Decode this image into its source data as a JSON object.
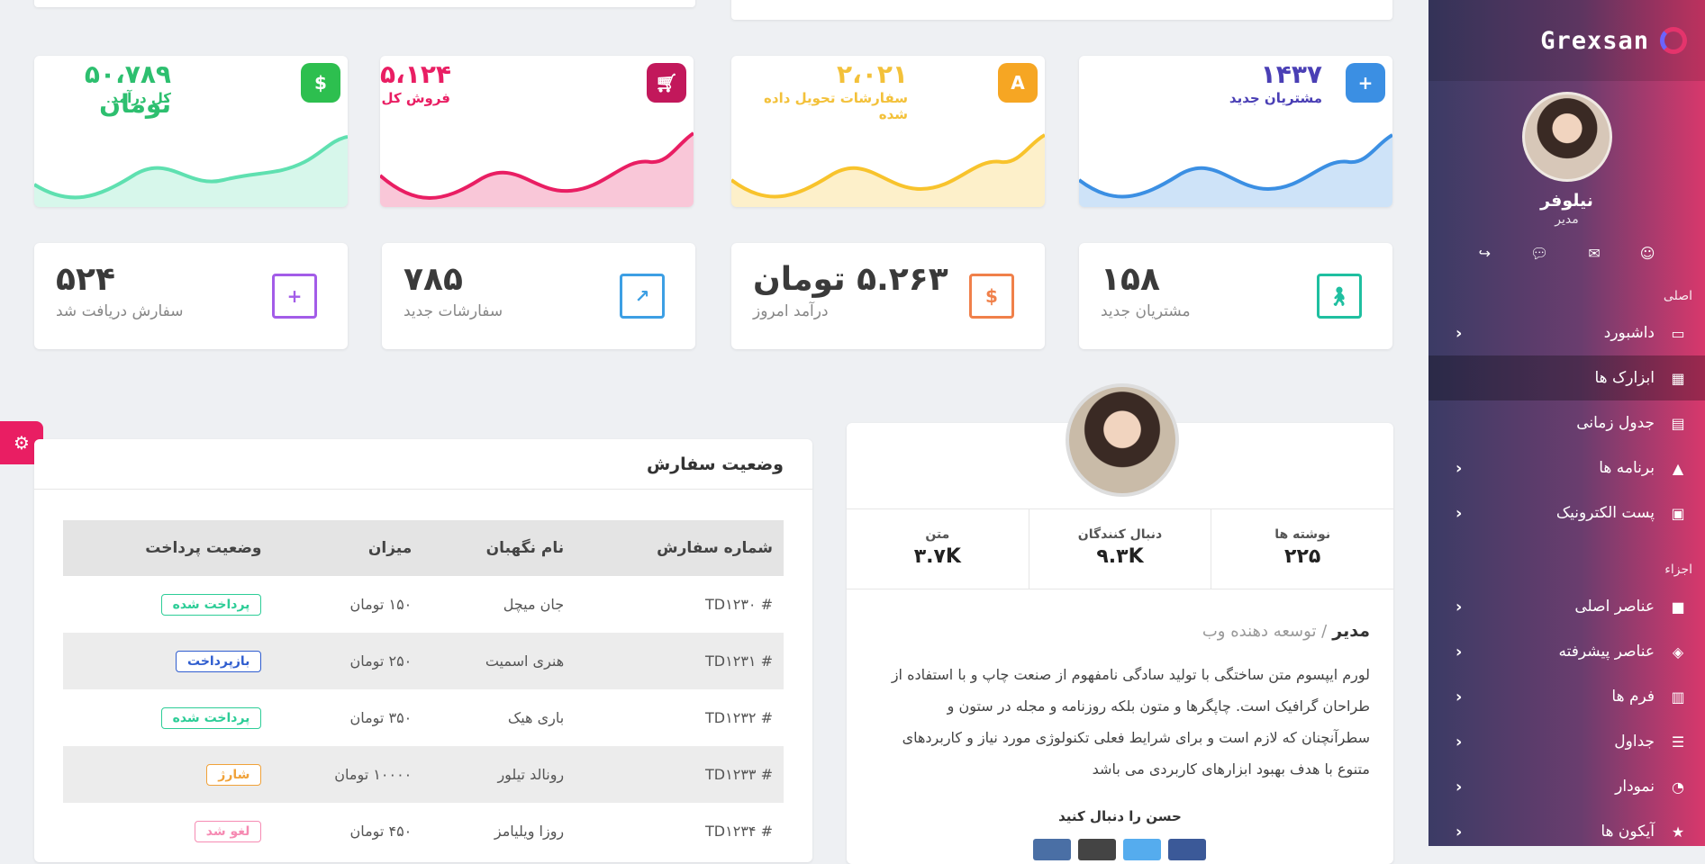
{
  "brand": {
    "name": "Grexsan"
  },
  "user": {
    "name": "نیلوفر",
    "role": "مدیر"
  },
  "sidebar": {
    "sections": [
      "اصلی",
      "اجزاء"
    ],
    "items": [
      {
        "label": "داشبورد",
        "icon": "monitor-icon"
      },
      {
        "label": "ابزارک ها",
        "icon": "widgets-icon"
      },
      {
        "label": "جدول زمانی",
        "icon": "calendar-icon"
      },
      {
        "label": "برنامه ها",
        "icon": "apps-icon"
      },
      {
        "label": "پست الکترونیک",
        "icon": "inbox-icon"
      },
      {
        "label": "عناصر اصلی",
        "icon": "briefcase-icon"
      },
      {
        "label": "عناصر پیشرفته",
        "icon": "cubes-icon"
      },
      {
        "label": "فرم ها",
        "icon": "form-icon"
      },
      {
        "label": "جداول",
        "icon": "table-icon"
      },
      {
        "label": "نمودار",
        "icon": "chart-icon"
      },
      {
        "label": "آیکون ها",
        "icon": "icons-icon"
      }
    ]
  },
  "wave_cards": [
    {
      "value": "۱۴۳۷",
      "label": "مشتریان جدید",
      "color": "#3b8fe3",
      "icon": "user-plus-icon"
    },
    {
      "value": "۲،۰۲۱",
      "label": "سفارشات تحویل داده شده",
      "color": "#f8c32c",
      "icon": "compass-icon"
    },
    {
      "value": "۵،۱۲۴",
      "label": "فروش کل",
      "color": "#e91e63",
      "icon": "cart-icon"
    },
    {
      "value": "۵۰،۷۸۹ تومان",
      "label": "کل درآمد",
      "color": "#2dbf6f",
      "icon": "dollar-icon"
    }
  ],
  "mini_cards": [
    {
      "value": "۱۵۸",
      "label": "مشتریان جدید",
      "color": "#1fbfa0",
      "icon": "person-walking-icon"
    },
    {
      "value": "۵.۲۶۳ تومان",
      "label": "درآمد امروز",
      "color": "#f0804a",
      "icon": "dollar-icon"
    },
    {
      "value": "۷۸۵",
      "label": "سفارشات جدید",
      "color": "#3d9fe4",
      "icon": "trend-icon"
    },
    {
      "value": "۵۲۴",
      "label": "سفارش دریافت شد",
      "color": "#a35ce8",
      "icon": "cart-plus-icon"
    }
  ],
  "orders": {
    "title": "وضعیت سفارش",
    "headers": [
      "شماره سفارش",
      "نام نگهبان",
      "میزان",
      "وضعیت پرداخت"
    ],
    "rows": [
      {
        "id": "# TD۱۲۳۰",
        "name": "جان میچل",
        "amount": "۱۵۰ تومان",
        "status": "پرداخت شده",
        "status_color": "#2dcd97"
      },
      {
        "id": "# TD۱۲۳۱",
        "name": "هنری اسمیت",
        "amount": "۲۵۰ تومان",
        "status": "بازپرداخت",
        "status_color": "#2f5dcf"
      },
      {
        "id": "# TD۱۲۳۲",
        "name": "باری هیک",
        "amount": "۳۵۰ تومان",
        "status": "پرداخت شده",
        "status_color": "#2dcd97"
      },
      {
        "id": "# TD۱۲۳۳",
        "name": "رونالد تیلور",
        "amount": "۱۰۰۰۰ تومان",
        "status": "شارژ",
        "status_color": "#f0a23a"
      },
      {
        "id": "# TD۱۲۳۴",
        "name": "روزا ویلیامز",
        "amount": "۴۵۰ تومان",
        "status": "لغو شد",
        "status_color": "#f68bb3"
      }
    ]
  },
  "profile_card": {
    "stats": [
      {
        "label": "نوشته ها",
        "value": "۲۲۵"
      },
      {
        "label": "دنبال کنندگان",
        "value": "۹.۳K"
      },
      {
        "label": "متن",
        "value": "۳.۷K"
      }
    ],
    "role": "مدیر",
    "title": "توسعه دهنده وب",
    "bio_lines": [
      "لورم ایپسوم متن ساختگی با تولید سادگی نامفهوم از صنعت چاپ و با استفاده از",
      "طراحان گرافیک است. چاپگرها و متون بلکه روزنامه و مجله در ستون و",
      "سطرآنچنان که لازم است و برای شرایط فعلی تکنولوژی مورد نیاز و کاربردهای",
      "متنوع با هدف بهبود ابزارهای کاربردی می باشد"
    ],
    "follow_text": "حسن را دنبال کنید",
    "social_colors": [
      "#4a6fa5",
      "#444444",
      "#55acee",
      "#3b5998"
    ]
  }
}
